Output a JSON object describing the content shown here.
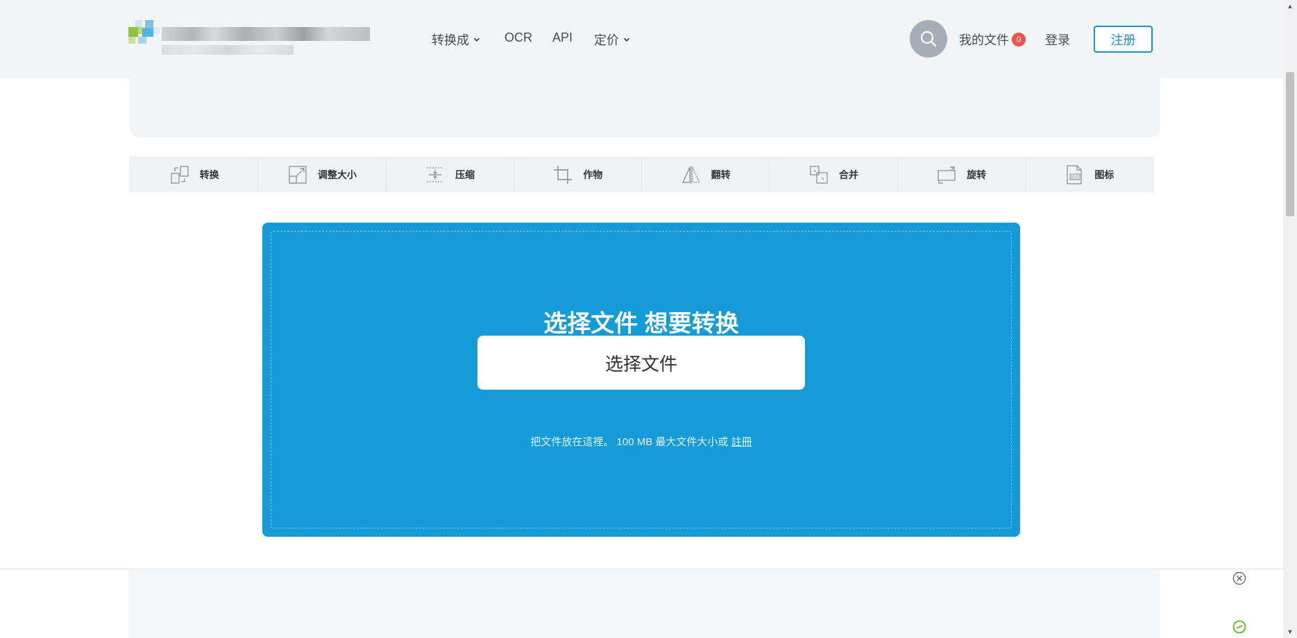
{
  "header": {
    "nav": [
      {
        "label": "转换成",
        "has_dropdown": true
      },
      {
        "label": "OCR",
        "has_dropdown": false
      },
      {
        "label": "API",
        "has_dropdown": false
      },
      {
        "label": "定价",
        "has_dropdown": true
      }
    ],
    "my_files_label": "我的文件",
    "my_files_count": "0",
    "login_label": "登录",
    "register_label": "注册"
  },
  "tools": [
    {
      "label": "转换",
      "icon": "convert-icon"
    },
    {
      "label": "调整大小",
      "icon": "resize-icon"
    },
    {
      "label": "压缩",
      "icon": "compress-icon"
    },
    {
      "label": "作物",
      "icon": "crop-icon"
    },
    {
      "label": "翻转",
      "icon": "flip-icon"
    },
    {
      "label": "合并",
      "icon": "merge-icon"
    },
    {
      "label": "旋转",
      "icon": "rotate-icon"
    },
    {
      "label": "图标",
      "icon": "ico-icon"
    }
  ],
  "upload": {
    "title": "选择文件 想要转换",
    "button_label": "选择文件",
    "note_prefix": "把文件放在這裡。 100 MB 最大文件大小或",
    "note_link": "註冊"
  },
  "colors": {
    "accent": "#159cd8",
    "register_border": "#1a8fcf",
    "badge": "#ef5350",
    "header_bg": "#f3f4f6"
  }
}
